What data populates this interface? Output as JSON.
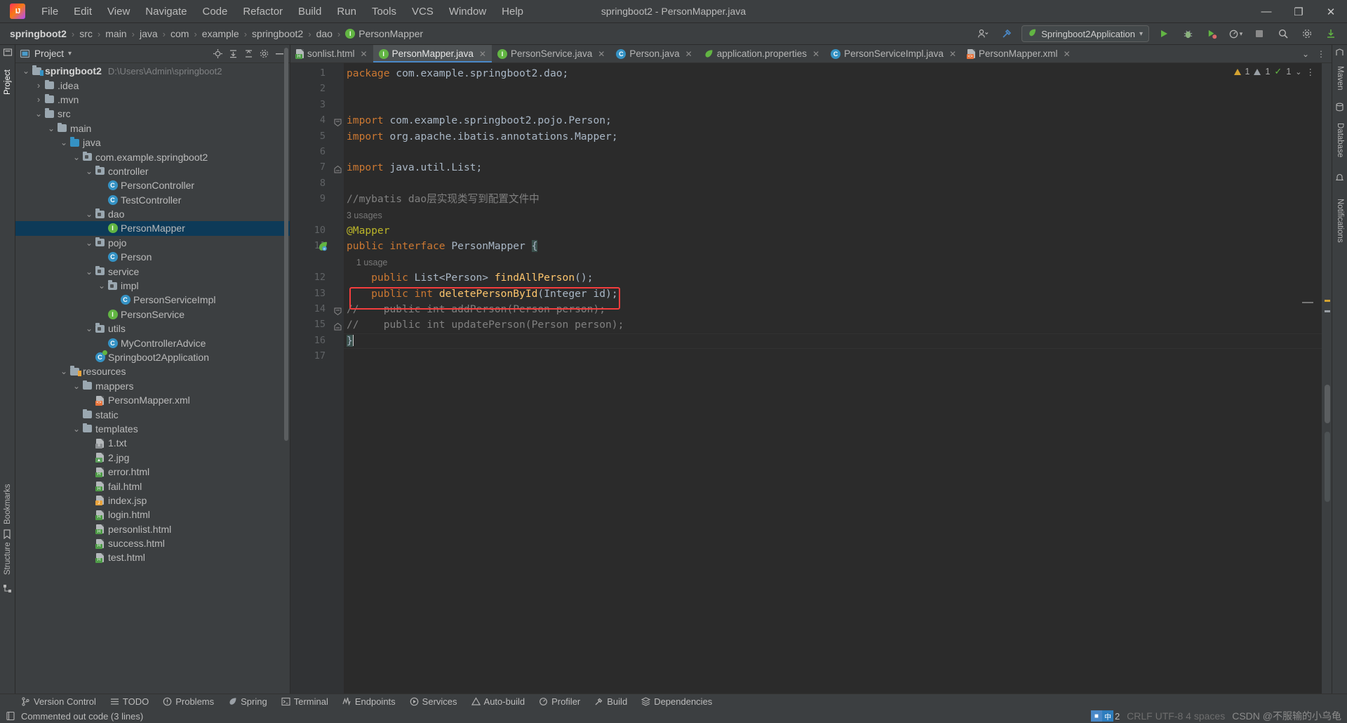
{
  "window": {
    "title": "springboot2 - PersonMapper.java",
    "minimize": "—",
    "maximize": "❐",
    "close": "✕"
  },
  "menubar": {
    "items": [
      "File",
      "Edit",
      "View",
      "Navigate",
      "Code",
      "Refactor",
      "Build",
      "Run",
      "Tools",
      "VCS",
      "Window",
      "Help"
    ]
  },
  "breadcrumb": {
    "items": [
      "springboot2",
      "src",
      "main",
      "java",
      "com",
      "example",
      "springboot2",
      "dao",
      "PersonMapper"
    ],
    "separator": "›"
  },
  "navright": {
    "run_config": "Springboot2Application",
    "dropdown_caret": "▾",
    "run_icon": "▶",
    "debug_icon": "debug-icon",
    "run_coverage_icon": "coverage-icon",
    "profiler_icon": "profiler-icon",
    "stop_icon": "■",
    "search_icon": "⚲",
    "settings_icon": "⚙",
    "updates_icon": "update-icon",
    "account_icon": "☺",
    "hammer_icon": "⚒"
  },
  "left_tool_strip": {
    "tabs": [
      "Project",
      "Bookmarks",
      "Structure"
    ]
  },
  "right_tool_strip": {
    "tabs": [
      "Maven",
      "Database",
      "Notifications"
    ]
  },
  "project_panel": {
    "title": "Project",
    "caret": "▾",
    "header_icons": [
      "locate-icon",
      "collapse-all-icon",
      "expand-icon",
      "settings-icon",
      "hide-icon"
    ],
    "tree": [
      {
        "depth": 0,
        "arrow": "⌄",
        "icon": "module-folder",
        "label": "springboot2",
        "path": "D:\\Users\\Admin\\springboot2",
        "bold": true
      },
      {
        "depth": 1,
        "arrow": "›",
        "icon": "folder",
        "label": ".idea"
      },
      {
        "depth": 1,
        "arrow": "›",
        "icon": "folder",
        "label": ".mvn"
      },
      {
        "depth": 1,
        "arrow": "⌄",
        "icon": "folder",
        "label": "src"
      },
      {
        "depth": 2,
        "arrow": "⌄",
        "icon": "folder",
        "label": "main"
      },
      {
        "depth": 3,
        "arrow": "⌄",
        "icon": "source-folder",
        "label": "java"
      },
      {
        "depth": 4,
        "arrow": "⌄",
        "icon": "package",
        "label": "com.example.springboot2"
      },
      {
        "depth": 5,
        "arrow": "⌄",
        "icon": "package",
        "label": "controller"
      },
      {
        "depth": 6,
        "arrow": "",
        "icon": "class",
        "label": "PersonController"
      },
      {
        "depth": 6,
        "arrow": "",
        "icon": "class",
        "label": "TestController"
      },
      {
        "depth": 5,
        "arrow": "⌄",
        "icon": "package",
        "label": "dao"
      },
      {
        "depth": 6,
        "arrow": "",
        "icon": "interface",
        "label": "PersonMapper",
        "selected": true
      },
      {
        "depth": 5,
        "arrow": "⌄",
        "icon": "package",
        "label": "pojo"
      },
      {
        "depth": 6,
        "arrow": "",
        "icon": "class",
        "label": "Person"
      },
      {
        "depth": 5,
        "arrow": "⌄",
        "icon": "package",
        "label": "service"
      },
      {
        "depth": 6,
        "arrow": "⌄",
        "icon": "package",
        "label": "impl"
      },
      {
        "depth": 7,
        "arrow": "",
        "icon": "class",
        "label": "PersonServiceImpl"
      },
      {
        "depth": 6,
        "arrow": "",
        "icon": "interface",
        "label": "PersonService"
      },
      {
        "depth": 5,
        "arrow": "⌄",
        "icon": "package",
        "label": "utils"
      },
      {
        "depth": 6,
        "arrow": "",
        "icon": "class",
        "label": "MyControllerAdvice"
      },
      {
        "depth": 5,
        "arrow": "",
        "icon": "spring-class",
        "label": "Springboot2Application"
      },
      {
        "depth": 3,
        "arrow": "⌄",
        "icon": "resource-folder",
        "label": "resources"
      },
      {
        "depth": 4,
        "arrow": "⌄",
        "icon": "folder",
        "label": "mappers"
      },
      {
        "depth": 5,
        "arrow": "",
        "icon": "xml-file",
        "label": "PersonMapper.xml"
      },
      {
        "depth": 4,
        "arrow": "",
        "icon": "folder",
        "label": "static"
      },
      {
        "depth": 4,
        "arrow": "⌄",
        "icon": "folder",
        "label": "templates"
      },
      {
        "depth": 5,
        "arrow": "",
        "icon": "txt-file",
        "label": "1.txt"
      },
      {
        "depth": 5,
        "arrow": "",
        "icon": "img-file",
        "label": "2.jpg"
      },
      {
        "depth": 5,
        "arrow": "",
        "icon": "html-file",
        "label": "error.html"
      },
      {
        "depth": 5,
        "arrow": "",
        "icon": "html-file",
        "label": "fail.html"
      },
      {
        "depth": 5,
        "arrow": "",
        "icon": "jsp-file",
        "label": "index.jsp"
      },
      {
        "depth": 5,
        "arrow": "",
        "icon": "html-file",
        "label": "login.html"
      },
      {
        "depth": 5,
        "arrow": "",
        "icon": "html-file",
        "label": "personlist.html"
      },
      {
        "depth": 5,
        "arrow": "",
        "icon": "html-file",
        "label": "success.html"
      },
      {
        "depth": 5,
        "arrow": "",
        "icon": "html-file",
        "label": "test.html"
      }
    ]
  },
  "editor_tabs": {
    "items": [
      {
        "label": "sonlist.html",
        "icon": "html-file",
        "active": false,
        "truncated": true
      },
      {
        "label": "PersonMapper.java",
        "icon": "interface",
        "active": true
      },
      {
        "label": "PersonService.java",
        "icon": "interface",
        "active": false
      },
      {
        "label": "Person.java",
        "icon": "class",
        "active": false
      },
      {
        "label": "application.properties",
        "icon": "spring-file",
        "active": false
      },
      {
        "label": "PersonServiceImpl.java",
        "icon": "class",
        "active": false
      },
      {
        "label": "PersonMapper.xml",
        "icon": "xml-file",
        "active": false
      }
    ],
    "close_glyph": "✕",
    "more_glyph": "⌄",
    "menu_glyph": "⋮"
  },
  "editor": {
    "filename": "PersonMapper.java",
    "line_numbers": [
      "1",
      "2",
      "3",
      "4",
      "5",
      "6",
      "7",
      "8",
      "9",
      "10",
      "11",
      "12",
      "13",
      "14",
      "15",
      "16",
      "17"
    ],
    "lines": [
      {
        "n": "1",
        "segments": [
          {
            "t": "package ",
            "c": "kw"
          },
          {
            "t": "com.example.springboot2.dao;",
            "c": "typ"
          }
        ]
      },
      {
        "n": "2",
        "segments": []
      },
      {
        "n": "3",
        "segments": []
      },
      {
        "n": "4",
        "segments": [
          {
            "t": "import ",
            "c": "kw"
          },
          {
            "t": "com.example.springboot2.pojo.Person;",
            "c": "typ"
          }
        ],
        "fold": "start"
      },
      {
        "n": "5",
        "segments": [
          {
            "t": "import ",
            "c": "kw"
          },
          {
            "t": "org.apache.ibatis.annotations.",
            "c": "typ"
          },
          {
            "t": "Mapper",
            "c": "typ-strong"
          },
          {
            "t": ";",
            "c": "typ"
          }
        ]
      },
      {
        "n": "6",
        "segments": []
      },
      {
        "n": "7",
        "segments": [
          {
            "t": "import ",
            "c": "kw"
          },
          {
            "t": "java.util.List;",
            "c": "typ"
          }
        ],
        "fold": "end"
      },
      {
        "n": "8",
        "segments": []
      },
      {
        "n": "9",
        "segments": [
          {
            "t": "//mybatis dao层实现类写到配置文件中",
            "c": "cmt"
          }
        ]
      },
      {
        "n": "",
        "segments": [
          {
            "t": "3 usages",
            "c": "usages"
          }
        ],
        "hint": true
      },
      {
        "n": "10",
        "segments": [
          {
            "t": "@Mapper",
            "c": "ann"
          }
        ]
      },
      {
        "n": "11",
        "segments": [
          {
            "t": "public interface ",
            "c": "kw"
          },
          {
            "t": "PersonMapper ",
            "c": "typ"
          },
          {
            "t": "{",
            "c": "brace"
          }
        ],
        "gutter_icon": "spring-bean"
      },
      {
        "n": "",
        "segments": [
          {
            "t": "    1 usage",
            "c": "usages"
          }
        ],
        "hint": true
      },
      {
        "n": "12",
        "segments": [
          {
            "t": "    public ",
            "c": "kw"
          },
          {
            "t": "List<Person> ",
            "c": "typ"
          },
          {
            "t": "findAllPerson",
            "c": "mth"
          },
          {
            "t": "();",
            "c": "typ"
          }
        ]
      },
      {
        "n": "13",
        "segments": [
          {
            "t": "    public ",
            "c": "kw"
          },
          {
            "t": "int ",
            "c": "kw"
          },
          {
            "t": "deletePersonById",
            "c": "mth"
          },
          {
            "t": "(Integer id);",
            "c": "typ"
          }
        ],
        "boxed": true
      },
      {
        "n": "14",
        "segments": [
          {
            "t": "//    public int addPerson(Person person);",
            "c": "cmt"
          }
        ],
        "fold": "start2"
      },
      {
        "n": "15",
        "segments": [
          {
            "t": "//    public int updatePerson(Person person);",
            "c": "cmt"
          }
        ],
        "fold": "end2"
      },
      {
        "n": "16",
        "segments": [
          {
            "t": "}",
            "c": "brace"
          }
        ],
        "caret": true
      },
      {
        "n": "17",
        "segments": []
      }
    ],
    "inspection_counters": {
      "warnings": "1",
      "weak_warnings": "1",
      "checks": "1",
      "caret_glyph": "⌄",
      "menu_glyph": "⋮"
    }
  },
  "bottom_toolwindows": {
    "items": [
      {
        "label": "Version Control",
        "icon": "branch-icon"
      },
      {
        "label": "TODO",
        "icon": "list-icon"
      },
      {
        "label": "Problems",
        "icon": "problem-icon"
      },
      {
        "label": "Spring",
        "icon": "leaf-icon"
      },
      {
        "label": "Terminal",
        "icon": "terminal-icon"
      },
      {
        "label": "Endpoints",
        "icon": "endpoints-icon"
      },
      {
        "label": "Services",
        "icon": "services-icon"
      },
      {
        "label": "Auto-build",
        "icon": "autobuild-icon"
      },
      {
        "label": "Profiler",
        "icon": "profiler-icon"
      },
      {
        "label": "Build",
        "icon": "hammer-icon"
      },
      {
        "label": "Dependencies",
        "icon": "dependencies-icon"
      }
    ]
  },
  "statusbar": {
    "message": "Commented out code (3 lines)",
    "message_icon": "inspection-icon",
    "ime_label": "中",
    "ime_count": "2",
    "encoding_hint": "CRLF  UTF-8  4 spaces",
    "watermark": "CSDN @不服输的小乌龟"
  },
  "colors": {
    "bg_chrome": "#3c3f41",
    "bg_editor": "#2b2b2b",
    "accent_blue": "#4a88c7",
    "selection": "#0d3a58",
    "red_box": "#f43d3d",
    "keyword": "#cc7832",
    "method": "#ffc66d",
    "annotation": "#bbb529",
    "comment": "#808080",
    "text": "#a9b7c6"
  }
}
